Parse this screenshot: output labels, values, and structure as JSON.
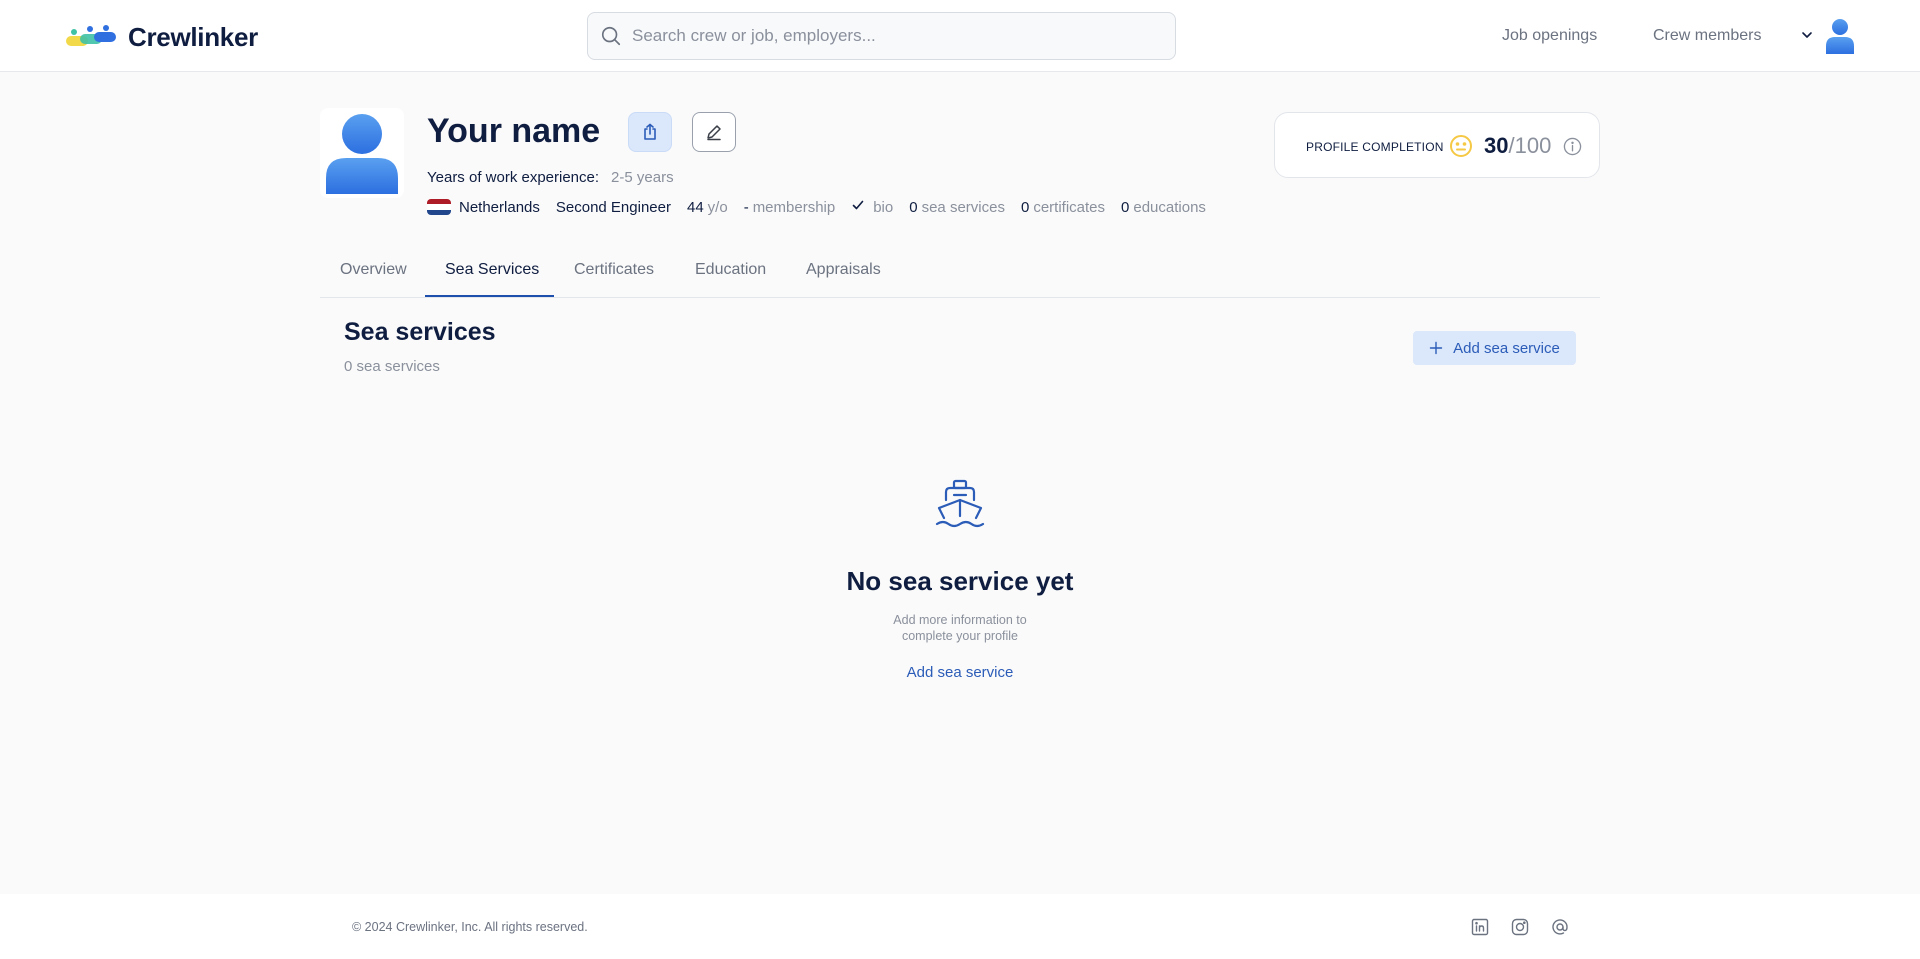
{
  "brand": {
    "name": "Crewlinker"
  },
  "search": {
    "placeholder": "Search crew or job, employers..."
  },
  "nav": {
    "job_openings": "Job openings",
    "crew_members": "Crew members"
  },
  "profile": {
    "name": "Your name",
    "experience_label": "Years of work experience:",
    "experience_value": "2-5 years",
    "country": "Netherlands",
    "rank": "Second Engineer",
    "age_value": "44",
    "age_unit": "y/o",
    "membership_value": "-",
    "membership_label": "membership",
    "bio_label": "bio",
    "sea_services_count": "0",
    "sea_services_label": "sea services",
    "certificates_count": "0",
    "certificates_label": "certificates",
    "educations_count": "0",
    "educations_label": "educations"
  },
  "completion": {
    "label": "PROFILE COMPLETION",
    "score": "30",
    "separator": "/",
    "max": "100"
  },
  "tabs": [
    {
      "label": "Overview"
    },
    {
      "label": "Sea Services"
    },
    {
      "label": "Certificates"
    },
    {
      "label": "Education"
    },
    {
      "label": "Appraisals"
    }
  ],
  "section": {
    "title": "Sea services",
    "count": "0 sea services",
    "add_button": "Add sea service"
  },
  "empty_state": {
    "title": "No sea service yet",
    "subtitle_line1": "Add more information to",
    "subtitle_line2": "complete your profile",
    "link": "Add sea service"
  },
  "footer": {
    "copyright": "© 2024 Crewlinker, Inc. All rights reserved."
  },
  "icons": {
    "search": "search-icon",
    "share": "share-icon",
    "edit": "pencil-icon",
    "face": "neutral-face-icon",
    "info": "info-icon",
    "plus": "plus-icon",
    "ship": "ship-icon",
    "linkedin": "linkedin-icon",
    "instagram": "instagram-icon",
    "email": "at-icon"
  },
  "colors": {
    "primary": "#2b5cb8",
    "primary_light": "#dbe7fb",
    "text": "#0f1d40",
    "muted": "#8a909c",
    "avatar_blue": "#4a8fe8",
    "face_yellow": "#f5c945"
  }
}
